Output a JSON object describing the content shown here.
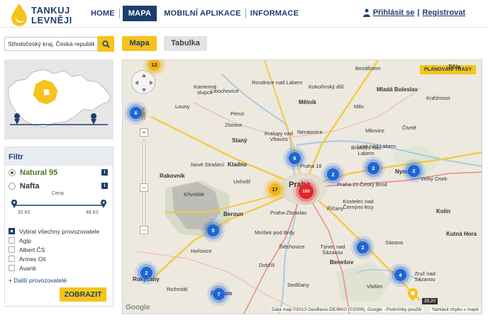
{
  "header": {
    "logo_line1": "TANKUJ",
    "logo_line2": "LEVNĚJI",
    "nav": [
      "HOME",
      "MAPA",
      "MOBILNÍ APLIKACE",
      "INFORMACE"
    ],
    "login": "Přihlásit se",
    "separator": "|",
    "register": "Registrovat"
  },
  "search": {
    "value": "Středočeský kraj, Česká republika"
  },
  "tabs": {
    "map": "Mapa",
    "table": "Tabulka"
  },
  "filter": {
    "title": "Filtr",
    "fuels": [
      "Natural 95",
      "Nafta"
    ],
    "selected_fuel": "Natural 95",
    "price_label": "Cena",
    "price_min": "32 Kč",
    "price_max": "48 Kč",
    "operators": [
      {
        "label": "Vybrat všechny provozovatele",
        "checked": true
      },
      {
        "label": "Agip",
        "checked": false
      },
      {
        "label": "Albert ČS",
        "checked": false
      },
      {
        "label": "Armex Oil",
        "checked": false
      },
      {
        "label": "Avanti",
        "checked": false
      }
    ],
    "more_operators": "Další provozovatelé",
    "show_button": "ZOBRAZIT"
  },
  "map": {
    "route_button": "PLÁNOVÁNÍ TRASY",
    "attribution": "Data map ©2013 GeoBasis-DE/BKG (©2009), Google - Podmínky použití",
    "report_error": "Nahlásit chybu v mapě",
    "price_tag": "39,20",
    "google": "Google",
    "towns": [
      "Roudnice nad Labem",
      "Mělník",
      "Mladá Boleslav",
      "Bezdězem",
      "Kokořínský důl",
      "Kněžmost",
      "Libochovice",
      "Kamenná slupce",
      "Milo",
      "Louny",
      "Peruc",
      "Slaný",
      "Zlonice",
      "Kralupy nad Vltavou",
      "Neratovice",
      "Brandýs nad Labem",
      "Kladno",
      "Nové Strašecí",
      "Rakovník",
      "Praha",
      "Praha 18",
      "Praha 21",
      "Český Brod",
      "Nymburk",
      "Velký Osek",
      "Křivoklát",
      "Unhošť",
      "Beroun",
      "Hořovice",
      "Praha-Zbraslav",
      "Říčany",
      "Kostelec nad Černými lesy",
      "Benešov",
      "Sázava",
      "Týnec nad Sázavou",
      "Štěchovice",
      "Dobříš",
      "Rokycany",
      "Příbram",
      "Lysá nad Labem",
      "Milovice",
      "Čtvrtě",
      "Jičín",
      "Kolín",
      "Kutná Hora",
      "Vlašim",
      "Zruč nad Sázavou",
      "Sedlčany",
      "Mníšek pod Brdy",
      "Rožmitál"
    ],
    "clusters": [
      {
        "label": "12",
        "color": "yellow"
      },
      {
        "label": "6",
        "color": "blue"
      },
      {
        "label": "6",
        "color": "blue"
      },
      {
        "label": "17",
        "color": "yellow"
      },
      {
        "label": "100",
        "color": "red"
      },
      {
        "label": "2",
        "color": "blue"
      },
      {
        "label": "2",
        "color": "blue"
      },
      {
        "label": "2",
        "color": "blue"
      },
      {
        "label": "5",
        "color": "blue"
      },
      {
        "label": "2",
        "color": "blue"
      },
      {
        "label": "2",
        "color": "blue"
      },
      {
        "label": "4",
        "color": "blue"
      },
      {
        "label": "7",
        "color": "blue"
      }
    ]
  }
}
